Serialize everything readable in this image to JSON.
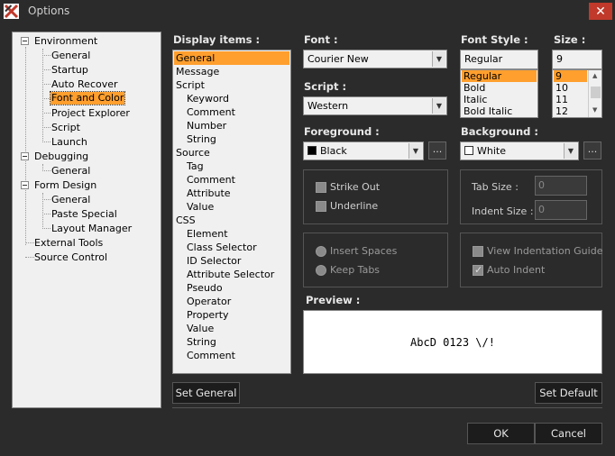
{
  "window": {
    "title": "Options"
  },
  "tree": {
    "items": [
      {
        "label": "Environment"
      },
      {
        "label": "General"
      },
      {
        "label": "Startup"
      },
      {
        "label": "Auto Recover"
      },
      {
        "label": "Font and Color"
      },
      {
        "label": "Project Explorer"
      },
      {
        "label": "Script"
      },
      {
        "label": "Launch"
      },
      {
        "label": "Debugging"
      },
      {
        "label": "General"
      },
      {
        "label": "Form Design"
      },
      {
        "label": "General"
      },
      {
        "label": "Paste Special"
      },
      {
        "label": "Layout Manager"
      },
      {
        "label": "External Tools"
      },
      {
        "label": "Source Control"
      }
    ],
    "selected": "Font and Color"
  },
  "display_items": {
    "label": "Display items :",
    "items": [
      {
        "label": "General"
      },
      {
        "label": "Message"
      },
      {
        "label": "Script"
      },
      {
        "label": "Keyword"
      },
      {
        "label": "Comment"
      },
      {
        "label": "Number"
      },
      {
        "label": "String"
      },
      {
        "label": "Source"
      },
      {
        "label": "Tag"
      },
      {
        "label": "Comment"
      },
      {
        "label": "Attribute"
      },
      {
        "label": "Value"
      },
      {
        "label": "CSS"
      },
      {
        "label": "Element"
      },
      {
        "label": "Class Selector"
      },
      {
        "label": "ID Selector"
      },
      {
        "label": "Attribute Selector"
      },
      {
        "label": "Pseudo"
      },
      {
        "label": "Operator"
      },
      {
        "label": "Property"
      },
      {
        "label": "Value"
      },
      {
        "label": "String"
      },
      {
        "label": "Comment"
      }
    ],
    "selected": "General"
  },
  "font": {
    "label": "Font :",
    "value": "Courier New"
  },
  "script": {
    "label": "Script :",
    "value": "Western"
  },
  "font_style": {
    "label": "Font Style :",
    "value": "Regular",
    "options": [
      "Regular",
      "Bold",
      "Italic",
      "Bold Italic"
    ],
    "selected": "Regular"
  },
  "size": {
    "label": "Size :",
    "value": "9",
    "options": [
      "9",
      "10",
      "11",
      "12"
    ],
    "selected": "9"
  },
  "foreground": {
    "label": "Foreground :",
    "value": "Black",
    "color": "#000000",
    "ellipsis": "..."
  },
  "background": {
    "label": "Background :",
    "value": "White",
    "color": "#ffffff",
    "ellipsis": "..."
  },
  "effects": {
    "strike_out": "Strike Out",
    "underline": "Underline"
  },
  "tabs": {
    "tab_size": "Tab Size :",
    "tab_size_value": "0",
    "indent_size": "Indent Size :",
    "indent_size_value": "0"
  },
  "indent_mode": {
    "insert_spaces": "Insert Spaces",
    "keep_tabs": "Keep Tabs"
  },
  "guides": {
    "view_indentation_guide": "View Indentation Guide",
    "auto_indent": "Auto Indent"
  },
  "preview": {
    "label": "Preview :",
    "text": "AbcD 0123 \\/!"
  },
  "buttons": {
    "set_general": "Set General",
    "set_default": "Set Default",
    "ok": "OK",
    "cancel": "Cancel"
  },
  "colors": {
    "accent": "#ff9f2e",
    "close": "#c0392b",
    "bg": "#2b2b2b"
  }
}
